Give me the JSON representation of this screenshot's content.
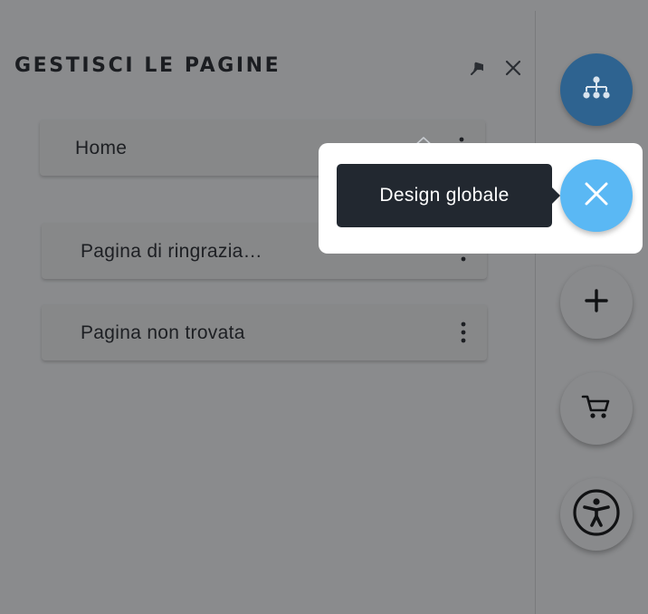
{
  "panel": {
    "title": "GESTISCI LE PAGINE",
    "icons": {
      "pin": "pin-icon",
      "close": "close-icon"
    }
  },
  "pages": [
    {
      "label": "Home",
      "is_home": true
    },
    {
      "label": "Pagina di ringrazia…",
      "is_home": false
    },
    {
      "label": "Pagina non trovata",
      "is_home": false
    }
  ],
  "tooltip": {
    "label": "Design globale"
  },
  "rail": {
    "buttons": [
      {
        "name": "sitemap",
        "icon": "sitemap-icon"
      },
      {
        "name": "global-design",
        "icon": "close-x-icon"
      },
      {
        "name": "add",
        "icon": "plus-icon"
      },
      {
        "name": "store",
        "icon": "cart-icon"
      },
      {
        "name": "accessibility",
        "icon": "accessibility-icon"
      }
    ]
  },
  "colors": {
    "overlay_grey": "#8a8b8d",
    "sitemap_button": "#2e6390",
    "active_button": "#5ab8f4",
    "tooltip_bg": "#222830",
    "spotlight": "#ffffff"
  }
}
